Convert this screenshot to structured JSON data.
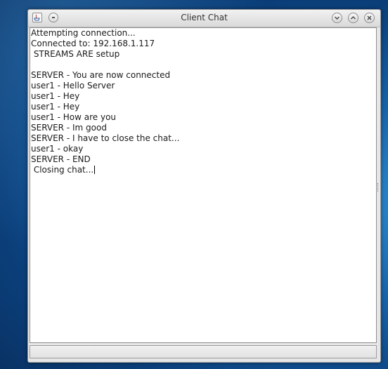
{
  "window": {
    "title": "Client Chat"
  },
  "chat": {
    "lines": [
      "Attempting connection...",
      "Connected to: 192.168.1.117",
      " STREAMS ARE setup",
      "",
      "SERVER - You are now connected",
      "user1 - Hello Server",
      "user1 - Hey",
      "user1 - Hey",
      "user1 - How are you",
      "SERVER - Im good",
      "SERVER - I have to close the chat...",
      "user1 - okay",
      "SERVER - END",
      " Closing chat..."
    ]
  },
  "input": {
    "value": ""
  },
  "icons": {
    "app": "java-app-icon",
    "menu": "window-menu-icon",
    "minimize": "chevron-down-icon",
    "maximize": "chevron-up-icon",
    "close": "close-icon"
  }
}
